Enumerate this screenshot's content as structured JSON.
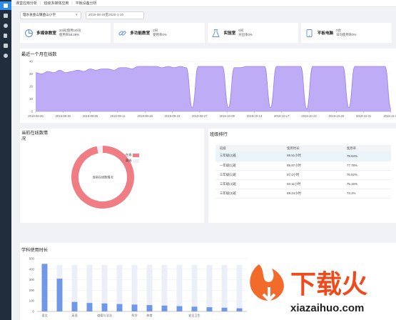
{
  "sidebar": {
    "items": [
      "dashboard-icon",
      "home-icon",
      "user-icon",
      "building-icon",
      "monitor-icon",
      "settings-icon"
    ]
  },
  "breadcrumb": {
    "items": [
      "课堂应用分析",
      "班级多媒体应用",
      "平板设备分析"
    ]
  },
  "filters": {
    "school": "理水县金山镇金山小学",
    "date_range": "2019-08-26至2020-1-10"
  },
  "cards": [
    {
      "title": "多媒体教室",
      "line1": "34间(使用14间)",
      "line2": "使用率58.28%",
      "icon": "pie-icon"
    },
    {
      "title": "多功能教室",
      "line1": "2间",
      "line2": "使用率0%",
      "icon": "link-icon"
    },
    {
      "title": "实验室",
      "line1": "0间",
      "line2": "开出率0%",
      "icon": "flask-icon"
    },
    {
      "title": "平板电脑",
      "line1": "0台",
      "line2": "日均使用率0%",
      "icon": "tablet-icon"
    }
  ],
  "trend": {
    "title": "最近一个月在线数",
    "chart_data": {
      "type": "area",
      "ylim": [
        0,
        40
      ],
      "yticks": [
        0,
        10,
        20,
        30,
        40
      ],
      "xticks": [
        "2019-08-26",
        "2019-08-30",
        "2019-09-05",
        "2019-09-11",
        "2019-09-18",
        "2019-09-23",
        "2019-09-27",
        "2019-10-09",
        "2019-10-13",
        "2019-10-17",
        "2019-10-22",
        "2019-10-26",
        "2019-10-31",
        "2019-11-04"
      ],
      "values": [
        31,
        30,
        32,
        31,
        33,
        31,
        32,
        33,
        32,
        34,
        33,
        34,
        34,
        33,
        35,
        35,
        34,
        36,
        36,
        36,
        36,
        35,
        36,
        35,
        36,
        35,
        3,
        36,
        36,
        36,
        36,
        36,
        3,
        35,
        35,
        36,
        36,
        36,
        36,
        3,
        36,
        36,
        36,
        36,
        36,
        2,
        36,
        36,
        36,
        36,
        36,
        36,
        3,
        36,
        36,
        36,
        36,
        36,
        36,
        2
      ],
      "color": "#b39df5",
      "line_color": "#9b7fe8"
    }
  },
  "online_now": {
    "title": "当前在线数情况",
    "center_label": "当前在线数情况",
    "chart_data": {
      "type": "pie",
      "slices": [
        {
          "label": "在线",
          "value": 97,
          "color": "#f07c84"
        },
        {
          "label": "离线",
          "value": 3,
          "color": "#eef0f8"
        }
      ]
    }
  },
  "ranking": {
    "title": "班级排行",
    "columns": [
      "班级",
      "使用时长",
      "使用率"
    ],
    "rows": [
      [
        "三年级(2)班",
        "85.51小时",
        "78.04%"
      ],
      [
        "一年级(1)班",
        "85.87小时",
        "77.78%"
      ],
      [
        "三年级(1)班",
        "87.4小时",
        "76.52%"
      ],
      [
        "三年级(4)班",
        "83.11小时",
        "75.16%"
      ],
      [
        "三年级(3)班",
        "89.24小时",
        "73.1%"
      ]
    ]
  },
  "subject": {
    "title": "学科使用时长",
    "chart_data": {
      "type": "bar",
      "ylim": [
        0,
        500
      ],
      "yticks": [
        0,
        100,
        200,
        300,
        400,
        500
      ],
      "categories": [
        "语文",
        "数学",
        "英语",
        "音乐",
        "道德与法治",
        "美术",
        "科学",
        "体育",
        "书法",
        "综合实践",
        "安全卫生",
        "信息技术",
        "劳动",
        "其他"
      ],
      "xlabels": [
        "语文",
        "英语",
        "道德与法治",
        "科学",
        "体育",
        "安全卫生"
      ],
      "values": [
        450,
        310,
        90,
        80,
        75,
        70,
        65,
        60,
        55,
        50,
        45,
        40,
        35,
        30
      ],
      "capacity": 440,
      "bar_color": "#6f98e8",
      "bg_color": "#eceef8"
    }
  },
  "watermark": {
    "text": "下载火",
    "url": "xiazaihuo.com"
  }
}
